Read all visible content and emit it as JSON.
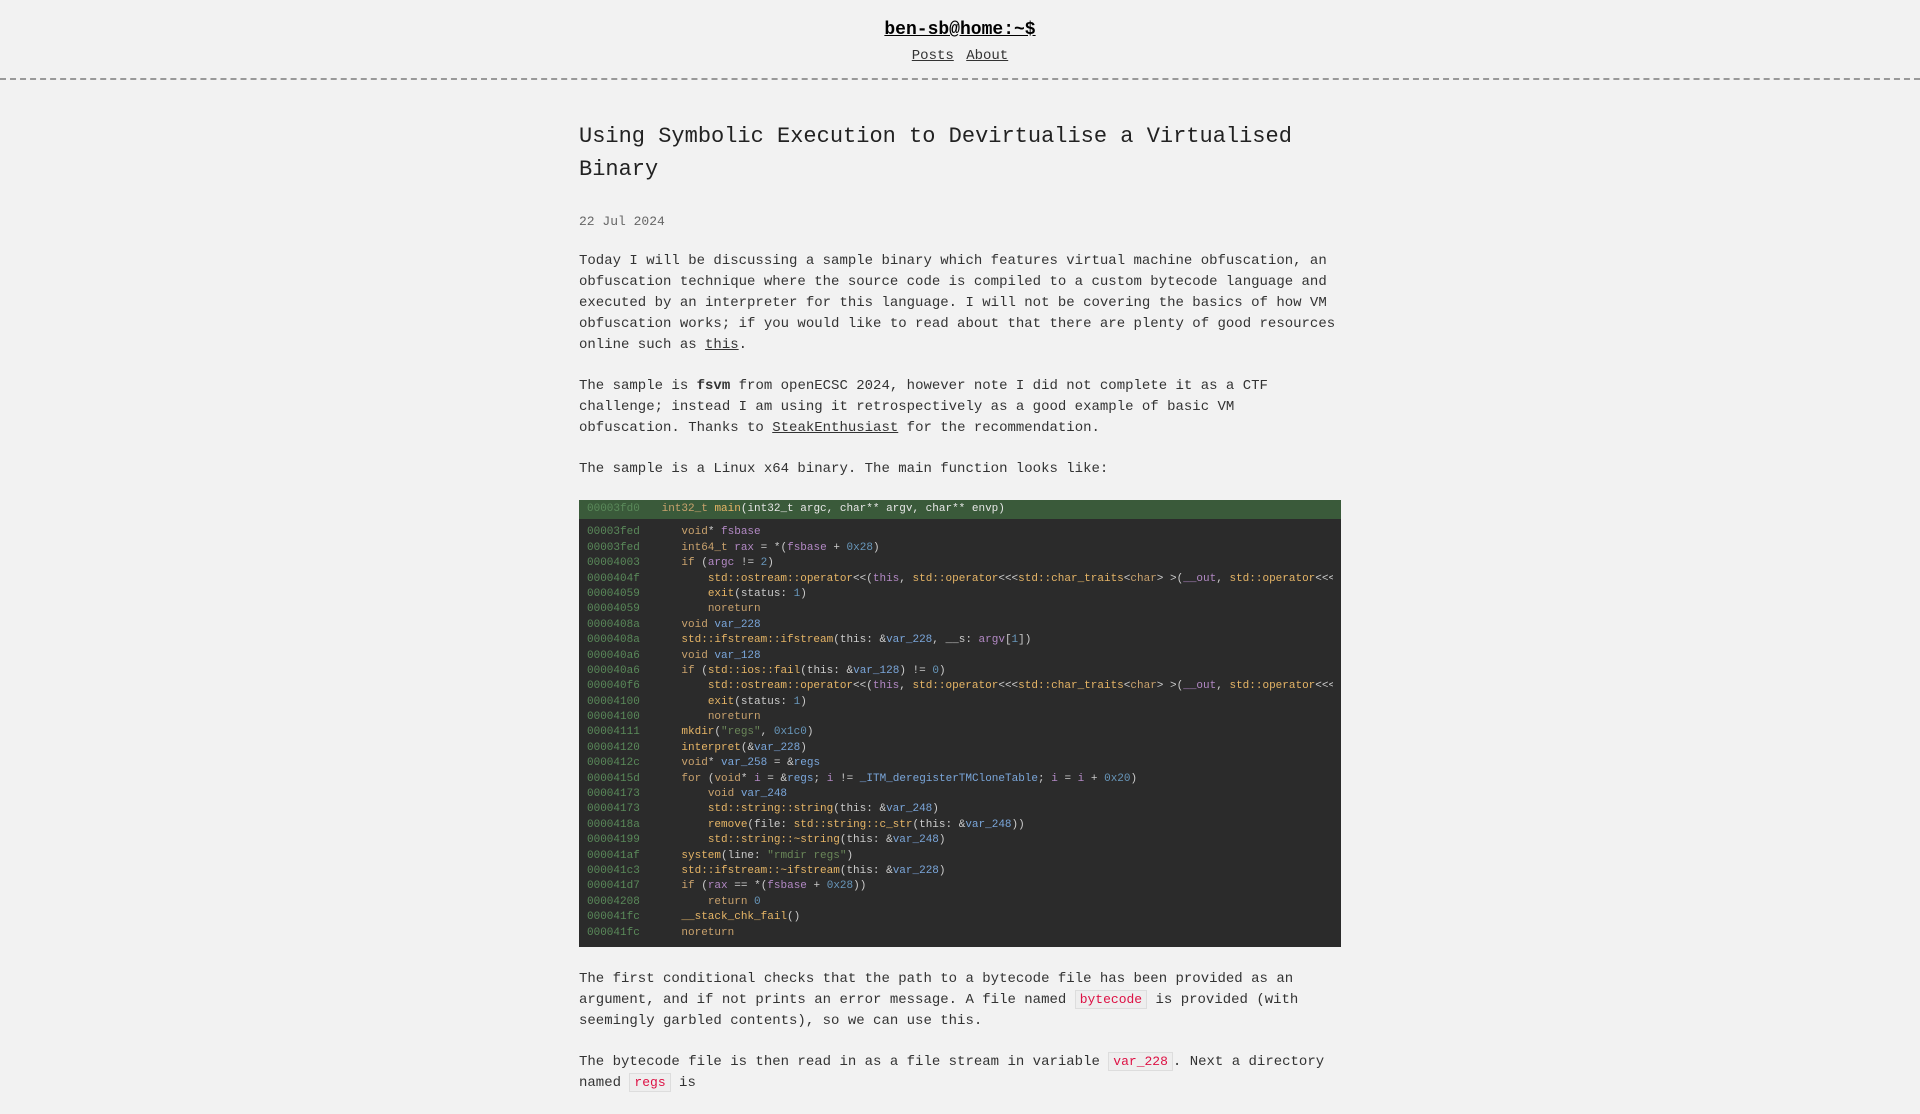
{
  "header": {
    "site_title": "ben-sb@home:~$",
    "nav": {
      "posts": "Posts",
      "about": "About"
    }
  },
  "post": {
    "title": "Using Symbolic Execution to Devirtualise a Virtualised Binary",
    "date": "22 Jul 2024",
    "p1_prefix": "Today I will be discussing a sample binary which features virtual machine obfuscation, an obfuscation technique where the source code is compiled to a custom bytecode language and executed by an interpreter for this language. I will not be covering the basics of how VM obfuscation works; if you would like to read about that there are plenty of good resources online such as ",
    "p1_link": "this",
    "p1_suffix": ".",
    "p2_prefix": "The sample is ",
    "p2_bold": "fsvm",
    "p2_mid": " from openECSC 2024, however note I did not complete it as a CTF challenge; instead I am using it retrospectively as a good example of basic VM obfuscation. Thanks to ",
    "p2_link": "SteakEnthusiast",
    "p2_suffix": " for the recommendation.",
    "p3": "The sample is a Linux x64 binary. The main function looks like:",
    "p4_prefix": "The first conditional checks that the path to a bytecode file has been provided as an argument, and if not prints an error message. A file named ",
    "p4_code": "bytecode",
    "p4_suffix": " is provided (with seemingly garbled contents), so we can use this.",
    "p5_prefix": "The bytecode file is then read in as a file stream in variable ",
    "p5_code1": "var_228",
    "p5_mid": ". Next a directory named ",
    "p5_code2": "regs",
    "p5_suffix": " is"
  },
  "code": {
    "header_addr": "00003fd0",
    "header_sig_type": "int32_t",
    "header_sig_name": "main",
    "header_sig_params": "(int32_t argc, char** argv, char** envp)",
    "rows": [
      {
        "addr": "00003fed",
        "indent": 1,
        "text": "void* fsbase"
      },
      {
        "addr": "00003fed",
        "indent": 1,
        "text": "int64_t rax = *(fsbase + 0x28)"
      },
      {
        "addr": "00004003",
        "indent": 1,
        "text": "if (argc != 2)"
      },
      {
        "addr": "0000404f",
        "indent": 2,
        "text": "std::ostream::operator<<(this, std::operator<<<std::char_traits<char> >(__out, std::operator<<<std::char_traits<char> >(__out, std::operator<"
      },
      {
        "addr": "00004059",
        "indent": 2,
        "text": "exit(status: 1)"
      },
      {
        "addr": "00004059",
        "indent": 2,
        "text": "noreturn"
      },
      {
        "addr": "0000408a",
        "indent": 1,
        "text": "void var_228"
      },
      {
        "addr": "0000408a",
        "indent": 1,
        "text": "std::ifstream::ifstream(this: &var_228, __s: argv[1])"
      },
      {
        "addr": "000040a6",
        "indent": 1,
        "text": "void var_128"
      },
      {
        "addr": "000040a6",
        "indent": 1,
        "text": "if (std::ios::fail(this: &var_128) != 0)"
      },
      {
        "addr": "000040f6",
        "indent": 2,
        "text": "std::ostream::operator<<(this, std::operator<<<std::char_traits<char> >(__out, std::operator<<<std::char_traits<char> >(__out, std::operator<"
      },
      {
        "addr": "00004100",
        "indent": 2,
        "text": "exit(status: 1)"
      },
      {
        "addr": "00004100",
        "indent": 2,
        "text": "noreturn"
      },
      {
        "addr": "00004111",
        "indent": 1,
        "text": "mkdir(\"regs\", 0x1c0)"
      },
      {
        "addr": "00004120",
        "indent": 1,
        "text": "interpret(&var_228)"
      },
      {
        "addr": "0000412c",
        "indent": 1,
        "text": "void* var_258 = &regs"
      },
      {
        "addr": "0000415d",
        "indent": 1,
        "text": "for (void* i = &regs; i != _ITM_deregisterTMCloneTable; i = i + 0x20)"
      },
      {
        "addr": "00004173",
        "indent": 2,
        "text": "void var_248"
      },
      {
        "addr": "00004173",
        "indent": 2,
        "text": "std::string::string(this: &var_248)"
      },
      {
        "addr": "0000418a",
        "indent": 2,
        "text": "remove(file: std::string::c_str(this: &var_248))"
      },
      {
        "addr": "00004199",
        "indent": 2,
        "text": "std::string::~string(this: &var_248)"
      },
      {
        "addr": "000041af",
        "indent": 1,
        "text": "system(line: \"rmdir regs\")"
      },
      {
        "addr": "000041c3",
        "indent": 1,
        "text": "std::ifstream::~ifstream(this: &var_228)"
      },
      {
        "addr": "000041d7",
        "indent": 1,
        "text": "if (rax == *(fsbase + 0x28))"
      },
      {
        "addr": "00004208",
        "indent": 2,
        "text": "return 0"
      },
      {
        "addr": "000041fc",
        "indent": 1,
        "text": "__stack_chk_fail()"
      },
      {
        "addr": "000041fc",
        "indent": 1,
        "text": "noreturn"
      }
    ]
  }
}
